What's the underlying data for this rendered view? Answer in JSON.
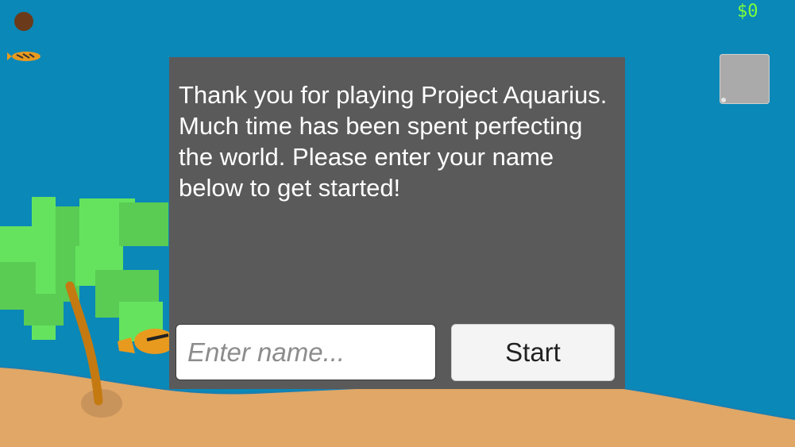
{
  "hud": {
    "money": "$0",
    "inventory_slot_icon": "empty-slot",
    "coconut_icon": "coconut-icon",
    "fish_icon": "fish-icon"
  },
  "dialog": {
    "message": "Thank you for playing Project Aquarius. Much time has been spent perfecting the world. Please enter your name below to get started!",
    "name_input": {
      "value": "",
      "placeholder": "Enter name..."
    },
    "start_label": "Start"
  },
  "colors": {
    "ocean": "#0a88b8",
    "sand": "#e0a766",
    "panel": "#5a5a5a",
    "money": "#7dff3a",
    "palm_leaves": "#6be85a",
    "palm_trunk": "#c47a10"
  }
}
